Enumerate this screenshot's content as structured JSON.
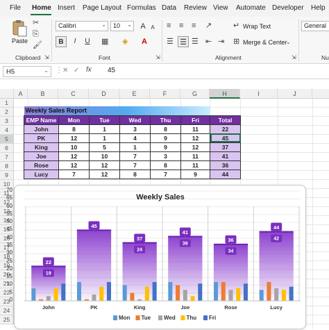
{
  "menu": {
    "tabs": [
      "File",
      "Home",
      "Insert",
      "Page Layout",
      "Formulas",
      "Data",
      "Review",
      "View",
      "Automate",
      "Developer",
      "Help"
    ],
    "active": "Home"
  },
  "ribbon": {
    "clipboard": {
      "paste_label": "Paste",
      "group_label": "Clipboard"
    },
    "font": {
      "font_name": "Calibri",
      "font_size": "10",
      "bold": "B",
      "italic": "I",
      "underline": "U",
      "grow": "A",
      "shrink": "A",
      "group_label": "Font"
    },
    "alignment": {
      "wrap_text": "Wrap Text",
      "merge_center": "Merge & Center",
      "group_label": "Alignment"
    },
    "number": {
      "format": "General",
      "group_label": "Nu"
    }
  },
  "formula_bar": {
    "name_box": "H5",
    "fx": "fx",
    "value": "45"
  },
  "grid": {
    "columns": [
      "A",
      "B",
      "C",
      "D",
      "E",
      "F",
      "G",
      "H",
      "I",
      "J"
    ],
    "rows": [
      "1",
      "2",
      "3",
      "4",
      "5",
      "6",
      "7",
      "8",
      "9",
      "10",
      "11",
      "12",
      "13",
      "14",
      "15",
      "16",
      "17",
      "18",
      "19",
      "20",
      "21",
      "22",
      "23",
      "24",
      "25"
    ],
    "selected_col": "H",
    "selected_row": "5"
  },
  "table": {
    "title": "Weekly Sales Report",
    "headers": [
      "EMP Name",
      "Mon",
      "Tue",
      "Wed",
      "Thu",
      "Fri",
      "Total"
    ],
    "rows": [
      [
        "John",
        "8",
        "1",
        "3",
        "8",
        "11",
        "22"
      ],
      [
        "PK",
        "12",
        "1",
        "4",
        "9",
        "12",
        "45"
      ],
      [
        "King",
        "10",
        "5",
        "1",
        "9",
        "12",
        "37"
      ],
      [
        "Joe",
        "12",
        "10",
        "7",
        "3",
        "11",
        "41"
      ],
      [
        "Rose",
        "12",
        "12",
        "7",
        "8",
        "11",
        "36"
      ],
      [
        "Lucy",
        "7",
        "12",
        "8",
        "7",
        "9",
        "44"
      ]
    ]
  },
  "colors": {
    "excel_green": "#1e7145",
    "header_purple": "#7030a0",
    "light_purple": "#d9c3f0",
    "Mon": "#5b9bd5",
    "Tue": "#ed7d31",
    "Wed": "#a5a5a5",
    "Thu": "#ffc000",
    "Fri": "#4472c4",
    "total_bar": "#8e44cf"
  },
  "chart_data": {
    "type": "bar",
    "title": "Weekly Sales",
    "categories": [
      "John",
      "PK",
      "King",
      "Joe",
      "Rose",
      "Lucy"
    ],
    "ylim": [
      0,
      70
    ],
    "yticks": [
      0,
      5,
      10,
      15,
      20,
      25,
      30,
      35,
      40,
      45,
      50,
      55,
      60,
      65,
      70
    ],
    "grid": true,
    "legend_position": "bottom",
    "series": [
      {
        "name": "Mon",
        "values": [
          8,
          12,
          10,
          12,
          12,
          7
        ]
      },
      {
        "name": "Tue",
        "values": [
          1,
          1,
          5,
          10,
          12,
          12
        ]
      },
      {
        "name": "Wed",
        "values": [
          3,
          4,
          1,
          7,
          7,
          8
        ]
      },
      {
        "name": "Thu",
        "values": [
          8,
          9,
          9,
          3,
          8,
          7
        ]
      },
      {
        "name": "Fri",
        "values": [
          11,
          12,
          12,
          11,
          11,
          9
        ]
      }
    ],
    "totals": [
      22,
      45,
      37,
      41,
      36,
      44
    ],
    "total_labels": [
      "22",
      "45",
      "37",
      "41",
      "36",
      "44"
    ],
    "inner_labels": [
      "19",
      "",
      "24",
      "36",
      "34",
      "42"
    ]
  }
}
